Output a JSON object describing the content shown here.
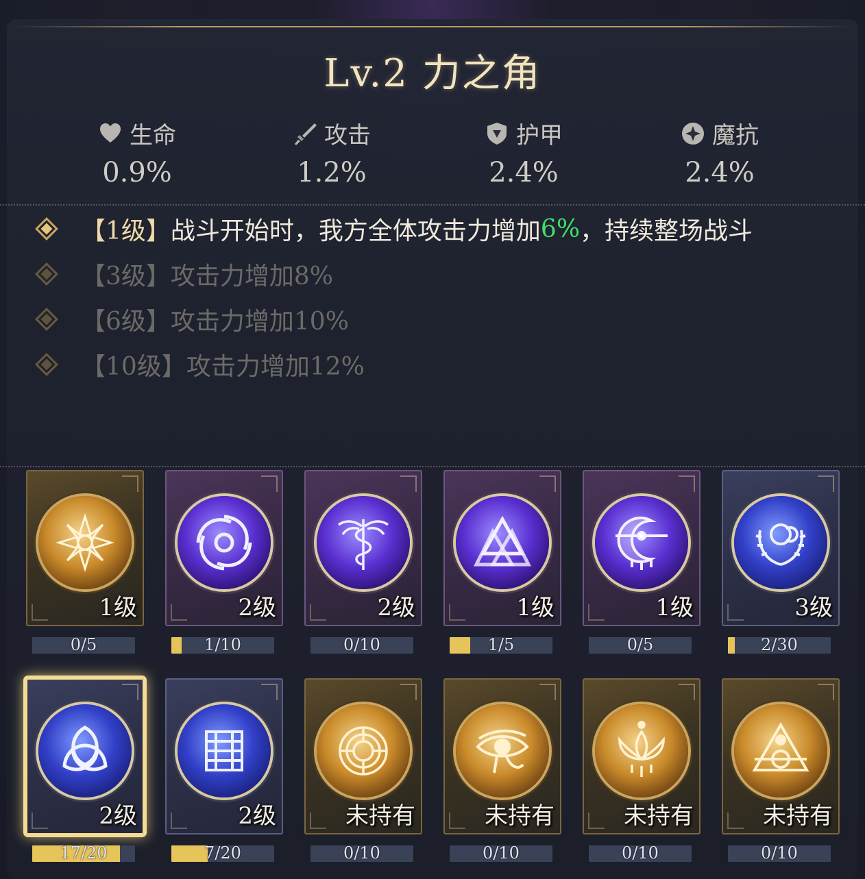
{
  "title": "Lv.2 力之角",
  "stats": [
    {
      "label": "生命",
      "value": "0.9%",
      "icon": "heart-icon"
    },
    {
      "label": "攻击",
      "value": "1.2%",
      "icon": "sword-icon"
    },
    {
      "label": "护甲",
      "value": "2.4%",
      "icon": "shield-icon"
    },
    {
      "label": "魔抗",
      "value": "2.4%",
      "icon": "magic-orb-icon"
    }
  ],
  "effects": [
    {
      "level": "【1级】",
      "pre": "战斗开始时，我方全体攻击力增加",
      "highlight": "6%",
      "post": "，持续整场战斗",
      "active": true
    },
    {
      "level": "【3级】",
      "pre": "攻击力增加8%",
      "highlight": "",
      "post": "",
      "active": false
    },
    {
      "level": "【6级】",
      "pre": "攻击力增加10%",
      "highlight": "",
      "post": "",
      "active": false
    },
    {
      "level": "【10级】",
      "pre": "攻击力增加12%",
      "highlight": "",
      "post": "",
      "active": false
    }
  ],
  "cards_row1": [
    {
      "level": "1级",
      "progress": "0/5",
      "fill": 0.0,
      "frame": "gold",
      "emblem": "gold",
      "icon": "lotus-flower-icon"
    },
    {
      "level": "2级",
      "progress": "1/10",
      "fill": 0.1,
      "frame": "purple",
      "emblem": "violet",
      "icon": "vortex-icon"
    },
    {
      "level": "2级",
      "progress": "0/10",
      "fill": 0.0,
      "frame": "purple",
      "emblem": "violet",
      "icon": "caduceus-icon"
    },
    {
      "level": "1级",
      "progress": "1/5",
      "fill": 0.2,
      "frame": "purple",
      "emblem": "violet",
      "icon": "valknut-icon"
    },
    {
      "level": "1级",
      "progress": "0/5",
      "fill": 0.0,
      "frame": "purple",
      "emblem": "violet",
      "icon": "crescent-moon-icon"
    },
    {
      "level": "3级",
      "progress": "2/30",
      "fill": 0.067,
      "frame": "blue",
      "emblem": "indigo",
      "icon": "laurel-moon-icon"
    }
  ],
  "cards_row2": [
    {
      "level": "2级",
      "progress": "17/20",
      "fill": 0.85,
      "frame": "blue",
      "emblem": "indigo",
      "icon": "triquetra-icon",
      "selected": true
    },
    {
      "level": "2级",
      "progress": "7/20",
      "fill": 0.35,
      "frame": "blue",
      "emblem": "indigo",
      "icon": "knot-symbol-icon"
    },
    {
      "level": "未持有",
      "progress": "0/10",
      "fill": 0.0,
      "frame": "gold",
      "emblem": "gold",
      "icon": "labyrinth-icon"
    },
    {
      "level": "未持有",
      "progress": "0/10",
      "fill": 0.0,
      "frame": "gold",
      "emblem": "gold",
      "icon": "eye-of-horus-icon"
    },
    {
      "level": "未持有",
      "progress": "0/10",
      "fill": 0.0,
      "frame": "gold",
      "emblem": "gold",
      "icon": "lotus-icon"
    },
    {
      "level": "未持有",
      "progress": "0/10",
      "fill": 0.0,
      "frame": "gold",
      "emblem": "gold",
      "icon": "triangle-icon"
    }
  ]
}
